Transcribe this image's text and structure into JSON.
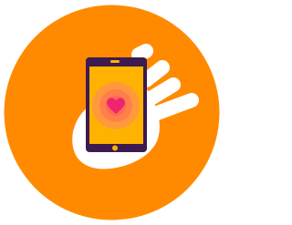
{
  "icon": {
    "name": "hand-holding-phone-heart-icon",
    "colors": {
      "circle": "#FF8A00",
      "hand": "#FFFFFF",
      "phone_frame": "#3D1A4F",
      "screen": "#FFB300",
      "glow_outer": "#FF9A3C",
      "glow_middle": "#FF7F4A",
      "glow_inner": "#FF6A55",
      "heart": "#F0246E"
    }
  }
}
